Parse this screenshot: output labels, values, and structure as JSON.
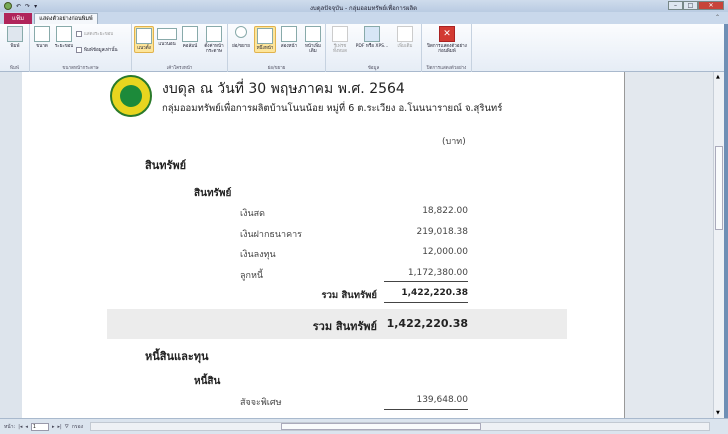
{
  "window": {
    "title": "งบดุลปัจจุบัน - กลุ่มออมทรัพย์เพื่อการผลิต"
  },
  "tabs": {
    "file": "แฟ้ม",
    "print_preview": "แสดงตัวอย่างก่อนพิมพ์"
  },
  "ribbon": {
    "print": {
      "button": "พิมพ์",
      "group": "พิมพ์"
    },
    "page_size": {
      "size": "ขนาด",
      "margins": "ระยะขอบ",
      "show_margins": "แสดงระยะขอบ",
      "print_data_only": "พิมพ์ข้อมูลเท่านั้น",
      "group": "ขนาดหน้ากระดาษ"
    },
    "page_layout": {
      "portrait": "แนวตั้ง",
      "landscape": "แนวนอน",
      "columns": "คอลัมน์",
      "page_setup": "ตั้งค่าหน้ากระดาษ",
      "group": "เค้าโครงหน้า"
    },
    "zoom": {
      "zoom": "ย่อ/ขยาย",
      "one_page": "หนึ่งหน้า",
      "two_pages": "สองหน้า",
      "more_pages": "หน้าเพิ่มเติม",
      "group": "ย่อ/ขยาย"
    },
    "data": {
      "refresh_all": "รีเฟรชทั้งหมด",
      "pdf_xps": "PDF หรือ XPS...",
      "more": "เพิ่มเติม",
      "group": "ข้อมูล"
    },
    "close": {
      "button": "ปิดการแสดงตัวอย่างก่อนพิมพ์",
      "group": "ปิดการแสดงตัวอย่าง"
    }
  },
  "report": {
    "title": "งบดุล  ณ วันที่ 30 พฤษภาคม พ.ศ. 2564",
    "subtitle": "กลุ่มออมทรัพย์เพื่อการผลิตบ้านโนนน้อย หมู่ที่ 6 ต.ระเวียง อ.โนนนารายณ์ จ.สุรินทร์",
    "unit": "(บาท)",
    "assets_heading": "สินทรัพย์",
    "assets_subheading": "สินทรัพย์",
    "assets": [
      {
        "label": "เงินสด",
        "amount": "18,822.00"
      },
      {
        "label": "เงินฝากธนาคาร",
        "amount": "219,018.38"
      },
      {
        "label": "เงินลงทุน",
        "amount": "12,000.00"
      },
      {
        "label": "ลูกหนี้",
        "amount": "1,172,380.00"
      }
    ],
    "assets_subtotal_label": "รวม สินทรัพย์",
    "assets_subtotal": "1,422,220.38",
    "assets_total_label": "รวม สินทรัพย์",
    "assets_total": "1,422,220.38",
    "liabilities_heading": "หนี้สินและทุน",
    "liabilities_subheading": "หนี้สิน",
    "liabilities": [
      {
        "label": "สัจจะพิเศษ",
        "amount": "139,648.00"
      }
    ]
  },
  "status": {
    "page_label": "หน้า:",
    "page_value": "1",
    "filter": "กรอง"
  }
}
